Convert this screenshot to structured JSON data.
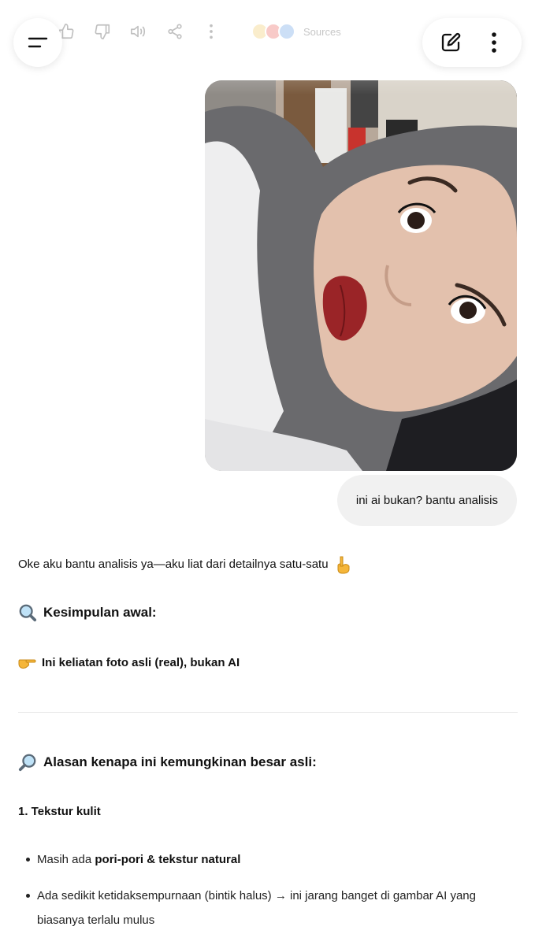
{
  "toolbar": {
    "icons": [
      "thumbs-up-icon",
      "thumbs-down-icon",
      "read-aloud-icon",
      "share-icon",
      "more-vertical-icon"
    ],
    "sources_label": "Sources",
    "source_colors": [
      "#f0c24a",
      "#e8433c",
      "#4a8fe0"
    ]
  },
  "header": {
    "menu_icon": "menu-icon",
    "new_chat_icon": "edit-icon",
    "more_icon": "more-vertical-icon"
  },
  "conversation": {
    "user_image": {
      "subject": "selfie of a person wearing a grey hijab",
      "colors": {
        "hijab": "#6a6a6d",
        "skin": "#e3c1ad",
        "lips": "#9a2427",
        "shirt": "#eeeeef"
      }
    },
    "user_message": "ini ai bukan? bantu analisis",
    "assistant": {
      "intro": "Oke aku bantu analisis ya—aku liat dari detailnya satu-satu",
      "intro_emoji": "pointing-down-emoji",
      "heading_summary": "Kesimpulan awal:",
      "heading_summary_emoji": "magnifier-left-emoji",
      "verdict": "Ini keliatan foto asli (real), bukan AI",
      "verdict_emoji": "pointing-right-emoji",
      "heading_reasons": "Alasan kenapa ini kemungkinan besar asli:",
      "heading_reasons_emoji": "magnifier-right-emoji",
      "section1_title": "1. Tekstur kulit",
      "bullet1_prefix": "Masih ada ",
      "bullet1_bold": "pori-pori & tekstur natural",
      "bullet2": "Ada sedikit ketidaksempurnaan (bintik halus) → ini jarang banget di gambar AI yang biasanya terlalu mulus"
    }
  }
}
